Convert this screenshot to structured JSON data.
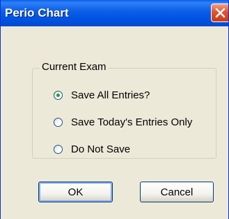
{
  "window": {
    "title": "Perio Chart"
  },
  "group": {
    "label": "Current Exam",
    "options": [
      {
        "label": "Save All Entries?",
        "checked": true
      },
      {
        "label": "Save Today's Entries Only",
        "checked": false
      },
      {
        "label": "Do Not Save",
        "checked": false
      }
    ]
  },
  "buttons": {
    "ok_label": "OK",
    "cancel_label": "Cancel"
  },
  "colors": {
    "titlebar": "#0054e3",
    "window_face": "#ece9d8",
    "close_button": "#e1532f",
    "radio_dot": "#21a121"
  },
  "icons": {
    "close": "close-icon"
  }
}
